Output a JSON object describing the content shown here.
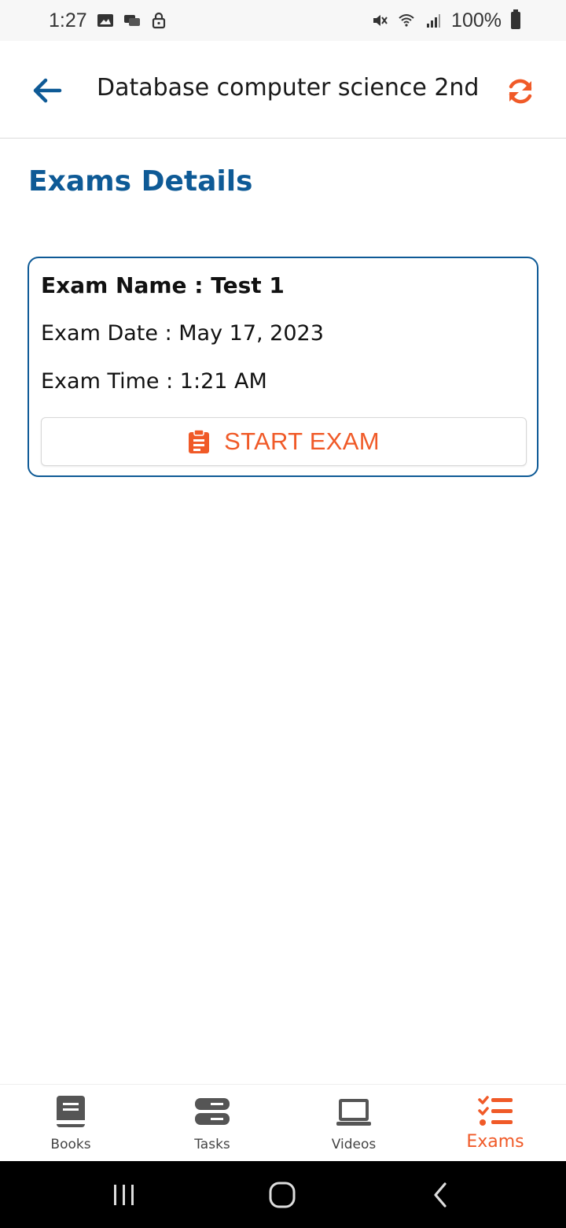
{
  "status_bar": {
    "time": "1:27",
    "battery": "100%"
  },
  "app_bar": {
    "title": "Database computer science 2nd"
  },
  "section_title": "Exams Details",
  "exam": {
    "name": "Exam Name : Test 1",
    "date": "Exam Date : May 17, 2023",
    "time": "Exam Time : 1:21 AM",
    "start_label": "START EXAM"
  },
  "bottom_nav": {
    "items": [
      {
        "label": "Books",
        "icon": "book-icon"
      },
      {
        "label": "Tasks",
        "icon": "tasks-icon"
      },
      {
        "label": "Videos",
        "icon": "laptop-icon"
      },
      {
        "label": "Exams",
        "icon": "checklist-icon"
      }
    ],
    "active": "Exams"
  },
  "colors": {
    "primary": "#0e5a96",
    "accent": "#f05a28",
    "nav_icon": "#555555"
  }
}
